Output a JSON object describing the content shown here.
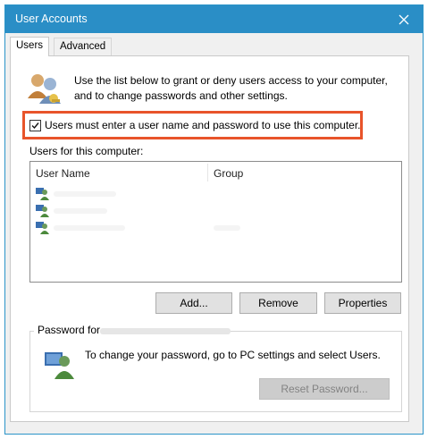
{
  "window": {
    "title": "User Accounts"
  },
  "tabs": [
    {
      "label": "Users"
    },
    {
      "label": "Advanced"
    }
  ],
  "intro": {
    "line1": "Use the list below to grant or deny users access to your computer,",
    "line2": "and to change passwords and other settings."
  },
  "require_password": {
    "label": "Users must enter a user name and password to use this computer.",
    "checked": true
  },
  "users_list": {
    "label": "Users for this computer:",
    "columns": [
      "User Name",
      "Group"
    ]
  },
  "buttons": {
    "add": "Add...",
    "remove": "Remove",
    "properties": "Properties",
    "reset_password": "Reset Password..."
  },
  "password_group": {
    "legend": "Password for",
    "text": "To change your password, go to PC settings and select Users."
  },
  "colors": {
    "titlebar": "#2a8ec6",
    "highlight": "#e8542a"
  }
}
